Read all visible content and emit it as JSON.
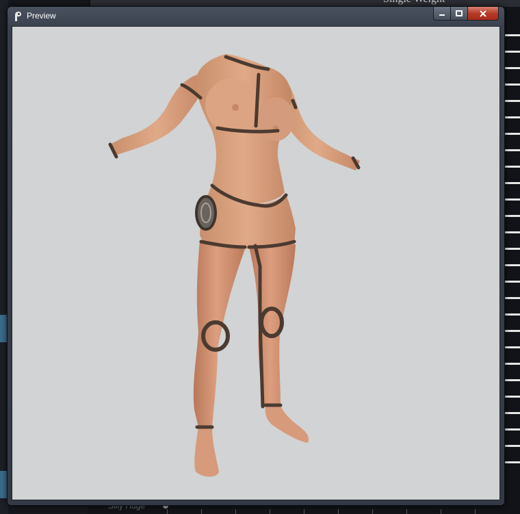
{
  "window": {
    "title": "Preview",
    "controls": {
      "minimize_icon": "minimize-icon",
      "maximize_icon": "maximize-icon",
      "close_icon": "close-icon"
    }
  },
  "background": {
    "heading": "Single Weight",
    "bottom_label": "Silly Huge"
  },
  "viewport": {
    "content": "3d-body-model",
    "background_color": "#d1d3d4"
  }
}
